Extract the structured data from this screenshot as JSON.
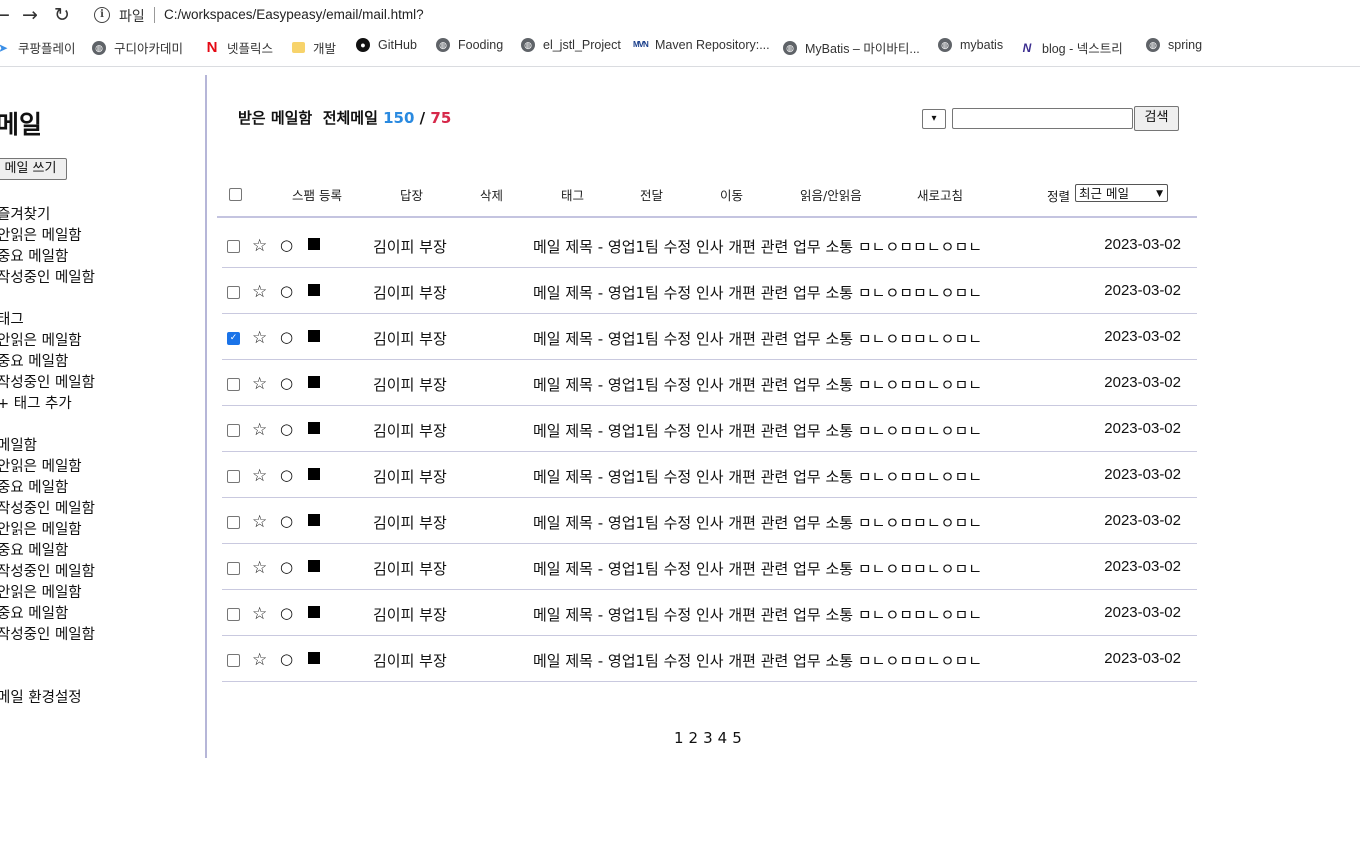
{
  "browser": {
    "back": "←",
    "forward": "→",
    "reload": "↻",
    "info": "i",
    "file_label": "파일",
    "url": "C:/workspaces/Easypeasy/email/mail.html?",
    "bookmarks": [
      {
        "label": "쿠팡플레이",
        "icon": "play-icon"
      },
      {
        "label": "구디아카데미",
        "icon": "globe-icon"
      },
      {
        "label": "넷플릭스",
        "icon": "netflix-icon"
      },
      {
        "label": "개발",
        "icon": "folder-icon"
      },
      {
        "label": "GitHub",
        "icon": "github-icon"
      },
      {
        "label": "Fooding",
        "icon": "globe-icon"
      },
      {
        "label": "el_jstl_Project",
        "icon": "globe-icon"
      },
      {
        "label": "Maven Repository:...",
        "icon": "maven-icon"
      },
      {
        "label": "MyBatis – 마이바티...",
        "icon": "globe-icon"
      },
      {
        "label": "mybatis",
        "icon": "globe-icon"
      },
      {
        "label": "blog - 넥스트리",
        "icon": "nextree-icon"
      },
      {
        "label": "spring",
        "icon": "globe-icon"
      }
    ]
  },
  "sidebar": {
    "title": "메일",
    "write_button": "메일 쓰기",
    "groups": [
      [
        "즐겨찾기",
        "안읽은 메일함",
        "중요 메일함",
        "작성중인 메일함"
      ],
      [
        "태그",
        "안읽은 메일함",
        "중요 메일함",
        "작성중인 메일함",
        "+ 태그 추가"
      ],
      [
        "메일함",
        "안읽은 메일함",
        "중요 메일함",
        "작성중인 메일함",
        "안읽은 메일함",
        "중요 메일함",
        "작성중인 메일함",
        "안읽은 메일함",
        "중요 메일함",
        "작성중인 메일함"
      ],
      [
        "메일 환경설정"
      ]
    ]
  },
  "header": {
    "title": "받은 메일함",
    "total_label": "전체메일",
    "total_count": "150",
    "slash": "/",
    "unread_count": "75",
    "colors": {
      "total": "#2a8ae0",
      "unread": "#d6284a"
    }
  },
  "search": {
    "select_value": "",
    "input_value": "",
    "button": "검색"
  },
  "toolbar": {
    "items": [
      "스팸 등록",
      "답장",
      "삭제",
      "태그",
      "전달",
      "이동",
      "읽음/안읽음",
      "새로고침"
    ],
    "sort_label": "정렬",
    "sort_value": "최근 메일"
  },
  "mails": [
    {
      "checked": false,
      "star": "☆",
      "circle": "○",
      "sender": "김이피 부장",
      "subject": "메일 제목 - 영업1팀 수정 인사 개편 관련 업무 소통 ㅁㄴㅇㅁㅁㄴㅇㅁㄴ",
      "date": "2023-03-02"
    },
    {
      "checked": false,
      "star": "☆",
      "circle": "○",
      "sender": "김이피 부장",
      "subject": "메일 제목 - 영업1팀 수정 인사 개편 관련 업무 소통 ㅁㄴㅇㅁㅁㄴㅇㅁㄴ",
      "date": "2023-03-02"
    },
    {
      "checked": true,
      "star": "☆",
      "circle": "○",
      "sender": "김이피 부장",
      "subject": "메일 제목 - 영업1팀 수정 인사 개편 관련 업무 소통 ㅁㄴㅇㅁㅁㄴㅇㅁㄴ",
      "date": "2023-03-02"
    },
    {
      "checked": false,
      "star": "☆",
      "circle": "○",
      "sender": "김이피 부장",
      "subject": "메일 제목 - 영업1팀 수정 인사 개편 관련 업무 소통 ㅁㄴㅇㅁㅁㄴㅇㅁㄴ",
      "date": "2023-03-02"
    },
    {
      "checked": false,
      "star": "☆",
      "circle": "○",
      "sender": "김이피 부장",
      "subject": "메일 제목 - 영업1팀 수정 인사 개편 관련 업무 소통 ㅁㄴㅇㅁㅁㄴㅇㅁㄴ",
      "date": "2023-03-02"
    },
    {
      "checked": false,
      "star": "☆",
      "circle": "○",
      "sender": "김이피 부장",
      "subject": "메일 제목 - 영업1팀 수정 인사 개편 관련 업무 소통 ㅁㄴㅇㅁㅁㄴㅇㅁㄴ",
      "date": "2023-03-02"
    },
    {
      "checked": false,
      "star": "☆",
      "circle": "○",
      "sender": "김이피 부장",
      "subject": "메일 제목 - 영업1팀 수정 인사 개편 관련 업무 소통 ㅁㄴㅇㅁㅁㄴㅇㅁㄴ",
      "date": "2023-03-02"
    },
    {
      "checked": false,
      "star": "☆",
      "circle": "○",
      "sender": "김이피 부장",
      "subject": "메일 제목 - 영업1팀 수정 인사 개편 관련 업무 소통 ㅁㄴㅇㅁㅁㄴㅇㅁㄴ",
      "date": "2023-03-02"
    },
    {
      "checked": false,
      "star": "☆",
      "circle": "○",
      "sender": "김이피 부장",
      "subject": "메일 제목 - 영업1팀 수정 인사 개편 관련 업무 소통 ㅁㄴㅇㅁㅁㄴㅇㅁㄴ",
      "date": "2023-03-02"
    },
    {
      "checked": false,
      "star": "☆",
      "circle": "○",
      "sender": "김이피 부장",
      "subject": "메일 제목 - 영업1팀 수정 인사 개편 관련 업무 소통 ㅁㄴㅇㅁㅁㄴㅇㅁㄴ",
      "date": "2023-03-02"
    }
  ],
  "pagination": [
    "1",
    "2",
    "3",
    "4",
    "5"
  ]
}
